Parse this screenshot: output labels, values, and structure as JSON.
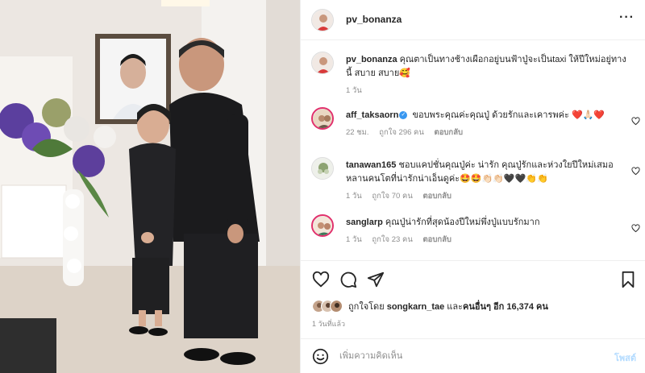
{
  "post": {
    "username": "pv_bonanza",
    "more_icon": "more-horizontal-icon"
  },
  "caption": {
    "username": "pv_bonanza",
    "text": "คุณตาเป็นทางช้างเผือกอยู่บนฟ้าปู่จะเป็นtaxi ให้ปีใหม่อยู่ทางนี้ สบาย สบาย🥰",
    "time": "1 วัน"
  },
  "comments": [
    {
      "username": "aff_taksaorn",
      "verified": true,
      "text": "ขอบพระคุณค่ะคุณปู่ ด้วยรักและเคารพค่ะ ❤️🙏🏻❤️",
      "time": "22 ชม.",
      "likes": "ถูกใจ 296 คน",
      "reply": "ตอบกลับ"
    },
    {
      "username": "tanawan165",
      "verified": false,
      "text": "ชอบแคปชั่นคุณปู่ค่ะ น่ารัก คุณปู่รักและห่วงใยปีใหม่เสมอ หลานคนโตที่น่ารักน่าเอ็นดูค่ะ🤩🤩👏🏻👏🏻🖤🖤👏👏",
      "time": "1 วัน",
      "likes": "ถูกใจ 70 คน",
      "reply": "ตอบกลับ"
    },
    {
      "username": "sanglarp",
      "verified": false,
      "text": "คุณปู่น่ารักที่สุดน้องปีใหม่พึ่งปู่แบบรักมาก",
      "time": "1 วัน",
      "likes": "ถูกใจ 23 คน",
      "reply": "ตอบกลับ"
    }
  ],
  "actions": {
    "like_icon": "heart-icon",
    "comment_icon": "comment-icon",
    "share_icon": "share-icon",
    "save_icon": "bookmark-icon"
  },
  "likes": {
    "prefix": "ถูกใจโดย",
    "first_user": "songkarn_tae",
    "joiner": "และ",
    "others": "คนอื่นๆ อีก 16,374 คน"
  },
  "date": "1 วันที่แล้ว",
  "add_comment": {
    "emoji_icon": "smiley-icon",
    "placeholder": "เพิ่มความคิดเห็น",
    "post_label": "โพสต์"
  },
  "colors": {
    "verified": "#3897f0",
    "post_button": "#b3dbff",
    "heart_red": "#ed4956"
  }
}
